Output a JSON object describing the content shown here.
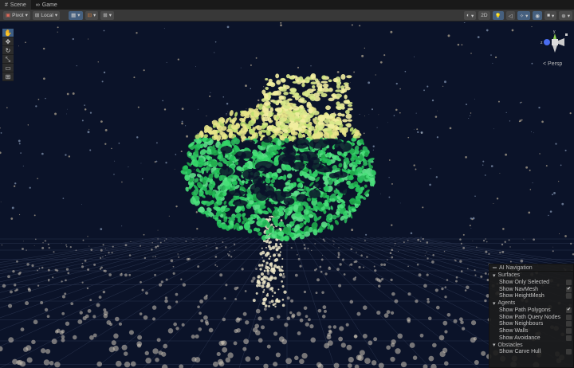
{
  "tabs": [
    {
      "label": "Scene",
      "icon": "grid-icon"
    },
    {
      "label": "Game",
      "icon": "gamepad-icon"
    }
  ],
  "toolbar": {
    "pivot": "Pivot",
    "local": "Local",
    "mode_2d": "2D"
  },
  "tools": [
    "hand",
    "move",
    "rotate",
    "scale",
    "rect",
    "transform"
  ],
  "gizmo": {
    "y": "y",
    "z": "z",
    "view": "< Persp"
  },
  "panel": {
    "title": "AI Navigation",
    "sections": [
      {
        "label": "Surfaces",
        "items": [
          {
            "label": "Show Only Selected",
            "checked": false
          },
          {
            "label": "Show NavMesh",
            "checked": true
          },
          {
            "label": "Show HeightMesh",
            "checked": false
          }
        ]
      },
      {
        "label": "Agents",
        "items": [
          {
            "label": "Show Path Polygons",
            "checked": true
          },
          {
            "label": "Show Path Query Nodes",
            "checked": false
          },
          {
            "label": "Show Neighbours",
            "checked": false
          },
          {
            "label": "Show Walls",
            "checked": false
          },
          {
            "label": "Show Avoidance",
            "checked": false
          }
        ]
      },
      {
        "label": "Obstacles",
        "items": [
          {
            "label": "Show Carve Hull",
            "checked": false
          }
        ]
      }
    ]
  }
}
